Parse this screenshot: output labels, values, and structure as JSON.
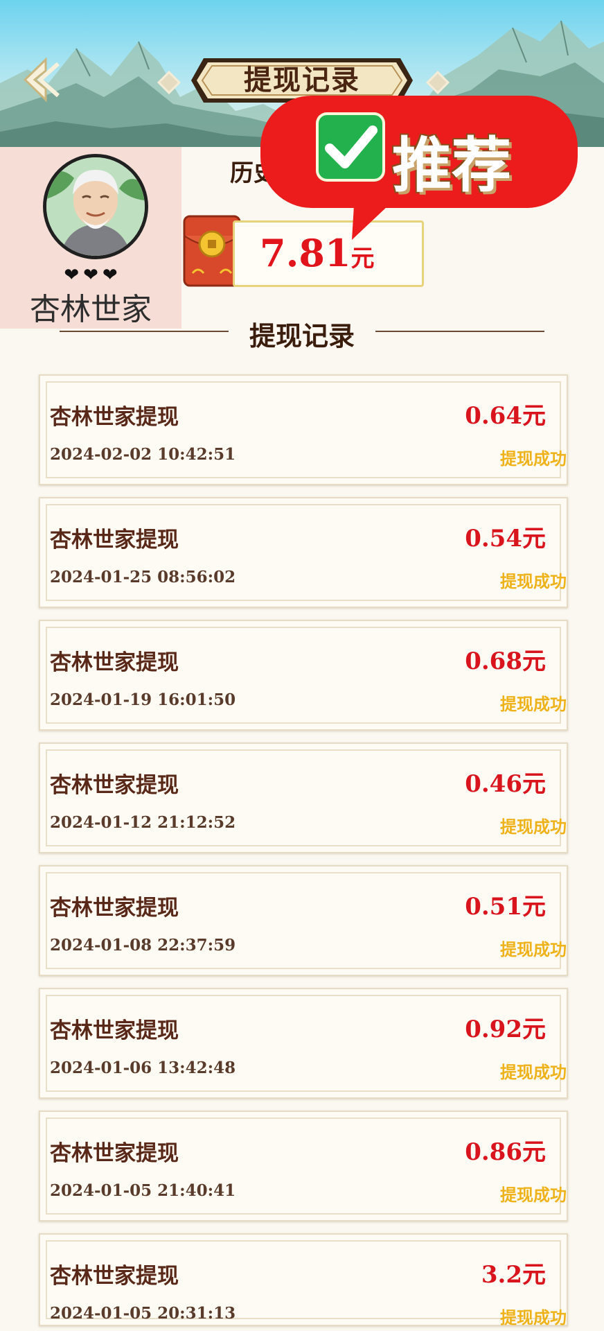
{
  "header": {
    "title": "提现记录",
    "back_icon": "back-arrow-icon"
  },
  "profile": {
    "name": "杏林世家",
    "hearts": "❤❤❤",
    "history_label": "历史",
    "balance_value": "7.81",
    "balance_unit": "元"
  },
  "badge": {
    "text": "推荐",
    "icon": "check-icon"
  },
  "section": {
    "title": "提现记录"
  },
  "records": [
    {
      "title": "杏林世家提现",
      "amount": "0.64元",
      "time": "2024-02-02 10:42:51",
      "status": "提现成功"
    },
    {
      "title": "杏林世家提现",
      "amount": "0.54元",
      "time": "2024-01-25 08:56:02",
      "status": "提现成功"
    },
    {
      "title": "杏林世家提现",
      "amount": "0.68元",
      "time": "2024-01-19 16:01:50",
      "status": "提现成功"
    },
    {
      "title": "杏林世家提现",
      "amount": "0.46元",
      "time": "2024-01-12 21:12:52",
      "status": "提现成功"
    },
    {
      "title": "杏林世家提现",
      "amount": "0.51元",
      "time": "2024-01-08 22:37:59",
      "status": "提现成功"
    },
    {
      "title": "杏林世家提现",
      "amount": "0.92元",
      "time": "2024-01-06 13:42:48",
      "status": "提现成功"
    },
    {
      "title": "杏林世家提现",
      "amount": "0.86元",
      "time": "2024-01-05 21:40:41",
      "status": "提现成功"
    },
    {
      "title": "杏林世家提现",
      "amount": "3.2元",
      "time": "2024-01-05 20:31:13",
      "status": "提现成功"
    }
  ],
  "colors": {
    "accent_red": "#d9141c",
    "status_gold": "#f0b21a",
    "badge_red": "#ec1c1c"
  }
}
